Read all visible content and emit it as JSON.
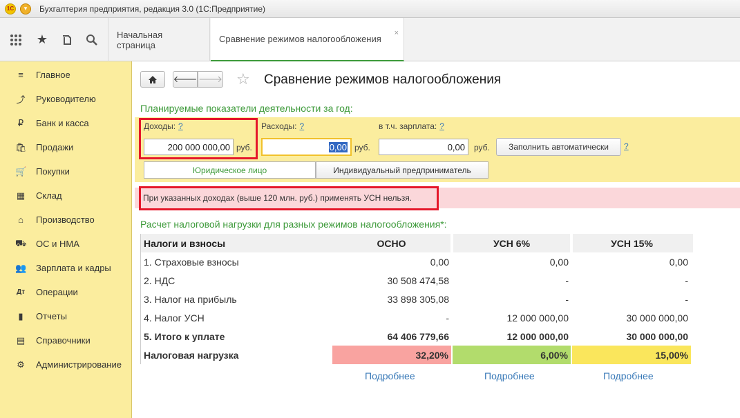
{
  "window": {
    "title": "Бухгалтерия предприятия, редакция 3.0  (1С:Предприятие)"
  },
  "tabs": [
    {
      "label": "Начальная страница"
    },
    {
      "label": "Сравнение режимов налогообложения",
      "close": "×"
    }
  ],
  "sidebar": {
    "items": [
      {
        "label": "Главное",
        "icon": "≡"
      },
      {
        "label": "Руководителю",
        "icon": "⤴"
      },
      {
        "label": "Банк и касса",
        "icon": "₽"
      },
      {
        "label": "Продажи",
        "icon": "🛍"
      },
      {
        "label": "Покупки",
        "icon": "🛒"
      },
      {
        "label": "Склад",
        "icon": "▦"
      },
      {
        "label": "Производство",
        "icon": "⌂"
      },
      {
        "label": "ОС и НМА",
        "icon": "⛟"
      },
      {
        "label": "Зарплата и кадры",
        "icon": "👥"
      },
      {
        "label": "Операции",
        "icon": "Дт"
      },
      {
        "label": "Отчеты",
        "icon": "▮"
      },
      {
        "label": "Справочники",
        "icon": "▤"
      },
      {
        "label": "Администрирование",
        "icon": "⚙"
      }
    ]
  },
  "page": {
    "title": "Сравнение режимов налогообложения",
    "planned_title": "Планируемые показатели деятельности за год:",
    "income": {
      "label": "Доходы:",
      "help": "?",
      "value": "200 000 000,00",
      "unit": "руб."
    },
    "expenses": {
      "label": "Расходы:",
      "help": "?",
      "value": "0,00",
      "unit": "руб."
    },
    "salary": {
      "label": "в т.ч. зарплата:",
      "help": "?",
      "value": "0,00",
      "unit": "руб."
    },
    "autofill_button": "Заполнить автоматически",
    "autofill_help": "?",
    "entity_types": [
      "Юридическое лицо",
      "Индивидуальный предприниматель"
    ],
    "warning": "При указанных доходах (выше 120 млн. руб.) применять УСН нельзя.",
    "calc_title": "Расчет налоговой нагрузки для разных режимов налогообложения*:"
  },
  "table": {
    "headers": [
      "Налоги и взносы",
      "ОСНО",
      "УСН 6%",
      "УСН 15%"
    ],
    "rows": [
      [
        "1. Страховые взносы",
        "0,00",
        "0,00",
        "0,00"
      ],
      [
        "2. НДС",
        "30 508 474,58",
        "-",
        "-"
      ],
      [
        "3. Налог на прибыль",
        "33 898 305,08",
        "-",
        "-"
      ],
      [
        "4. Налог УСН",
        "-",
        "12 000 000,00",
        "30 000 000,00"
      ],
      [
        "5. Итого к уплате",
        "64 406 779,66",
        "12 000 000,00",
        "30 000 000,00"
      ]
    ],
    "burden": [
      "Налоговая нагрузка",
      "32,20%",
      "6,00%",
      "15,00%"
    ],
    "burden_colors": [
      "#f9a3a0",
      "#b2dc6c",
      "#fae65c"
    ],
    "details_link": "Подробнее"
  }
}
